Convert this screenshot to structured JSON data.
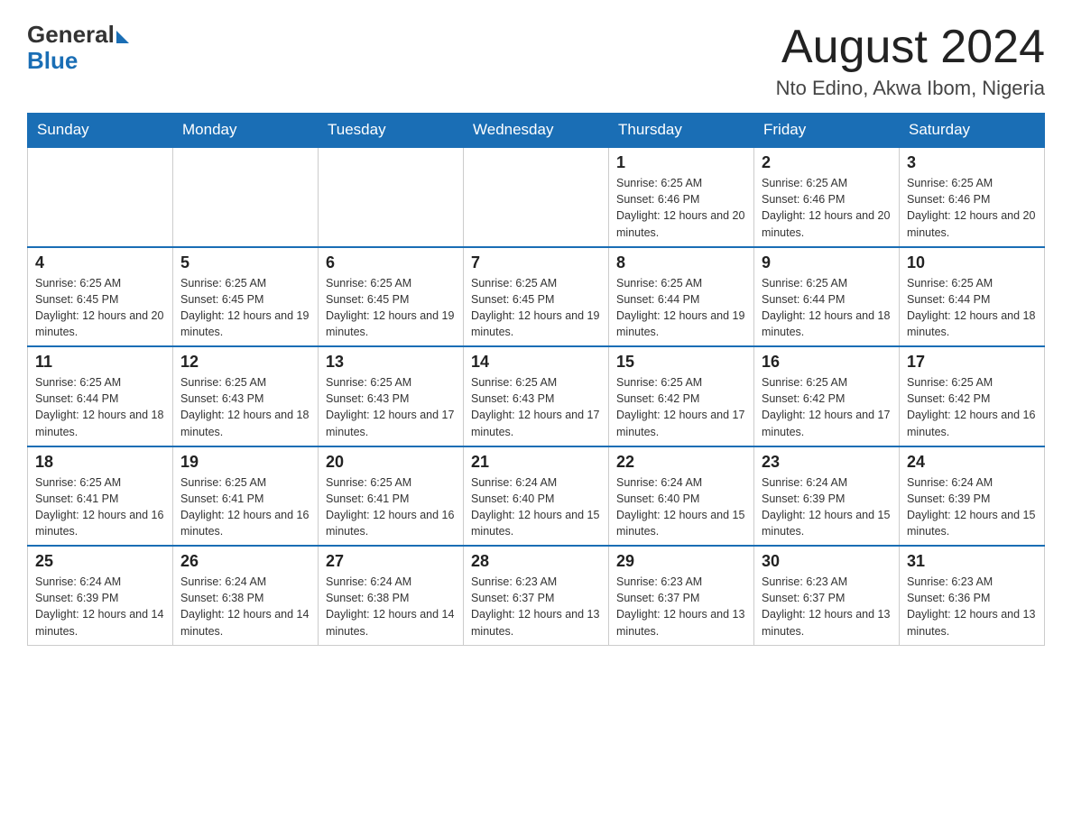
{
  "header": {
    "logo_general": "General",
    "logo_blue": "Blue",
    "title": "August 2024",
    "subtitle": "Nto Edino, Akwa Ibom, Nigeria"
  },
  "days_of_week": [
    "Sunday",
    "Monday",
    "Tuesday",
    "Wednesday",
    "Thursday",
    "Friday",
    "Saturday"
  ],
  "weeks": [
    [
      {
        "day": "",
        "sunrise": "",
        "sunset": "",
        "daylight": ""
      },
      {
        "day": "",
        "sunrise": "",
        "sunset": "",
        "daylight": ""
      },
      {
        "day": "",
        "sunrise": "",
        "sunset": "",
        "daylight": ""
      },
      {
        "day": "",
        "sunrise": "",
        "sunset": "",
        "daylight": ""
      },
      {
        "day": "1",
        "sunrise": "Sunrise: 6:25 AM",
        "sunset": "Sunset: 6:46 PM",
        "daylight": "Daylight: 12 hours and 20 minutes."
      },
      {
        "day": "2",
        "sunrise": "Sunrise: 6:25 AM",
        "sunset": "Sunset: 6:46 PM",
        "daylight": "Daylight: 12 hours and 20 minutes."
      },
      {
        "day": "3",
        "sunrise": "Sunrise: 6:25 AM",
        "sunset": "Sunset: 6:46 PM",
        "daylight": "Daylight: 12 hours and 20 minutes."
      }
    ],
    [
      {
        "day": "4",
        "sunrise": "Sunrise: 6:25 AM",
        "sunset": "Sunset: 6:45 PM",
        "daylight": "Daylight: 12 hours and 20 minutes."
      },
      {
        "day": "5",
        "sunrise": "Sunrise: 6:25 AM",
        "sunset": "Sunset: 6:45 PM",
        "daylight": "Daylight: 12 hours and 19 minutes."
      },
      {
        "day": "6",
        "sunrise": "Sunrise: 6:25 AM",
        "sunset": "Sunset: 6:45 PM",
        "daylight": "Daylight: 12 hours and 19 minutes."
      },
      {
        "day": "7",
        "sunrise": "Sunrise: 6:25 AM",
        "sunset": "Sunset: 6:45 PM",
        "daylight": "Daylight: 12 hours and 19 minutes."
      },
      {
        "day": "8",
        "sunrise": "Sunrise: 6:25 AM",
        "sunset": "Sunset: 6:44 PM",
        "daylight": "Daylight: 12 hours and 19 minutes."
      },
      {
        "day": "9",
        "sunrise": "Sunrise: 6:25 AM",
        "sunset": "Sunset: 6:44 PM",
        "daylight": "Daylight: 12 hours and 18 minutes."
      },
      {
        "day": "10",
        "sunrise": "Sunrise: 6:25 AM",
        "sunset": "Sunset: 6:44 PM",
        "daylight": "Daylight: 12 hours and 18 minutes."
      }
    ],
    [
      {
        "day": "11",
        "sunrise": "Sunrise: 6:25 AM",
        "sunset": "Sunset: 6:44 PM",
        "daylight": "Daylight: 12 hours and 18 minutes."
      },
      {
        "day": "12",
        "sunrise": "Sunrise: 6:25 AM",
        "sunset": "Sunset: 6:43 PM",
        "daylight": "Daylight: 12 hours and 18 minutes."
      },
      {
        "day": "13",
        "sunrise": "Sunrise: 6:25 AM",
        "sunset": "Sunset: 6:43 PM",
        "daylight": "Daylight: 12 hours and 17 minutes."
      },
      {
        "day": "14",
        "sunrise": "Sunrise: 6:25 AM",
        "sunset": "Sunset: 6:43 PM",
        "daylight": "Daylight: 12 hours and 17 minutes."
      },
      {
        "day": "15",
        "sunrise": "Sunrise: 6:25 AM",
        "sunset": "Sunset: 6:42 PM",
        "daylight": "Daylight: 12 hours and 17 minutes."
      },
      {
        "day": "16",
        "sunrise": "Sunrise: 6:25 AM",
        "sunset": "Sunset: 6:42 PM",
        "daylight": "Daylight: 12 hours and 17 minutes."
      },
      {
        "day": "17",
        "sunrise": "Sunrise: 6:25 AM",
        "sunset": "Sunset: 6:42 PM",
        "daylight": "Daylight: 12 hours and 16 minutes."
      }
    ],
    [
      {
        "day": "18",
        "sunrise": "Sunrise: 6:25 AM",
        "sunset": "Sunset: 6:41 PM",
        "daylight": "Daylight: 12 hours and 16 minutes."
      },
      {
        "day": "19",
        "sunrise": "Sunrise: 6:25 AM",
        "sunset": "Sunset: 6:41 PM",
        "daylight": "Daylight: 12 hours and 16 minutes."
      },
      {
        "day": "20",
        "sunrise": "Sunrise: 6:25 AM",
        "sunset": "Sunset: 6:41 PM",
        "daylight": "Daylight: 12 hours and 16 minutes."
      },
      {
        "day": "21",
        "sunrise": "Sunrise: 6:24 AM",
        "sunset": "Sunset: 6:40 PM",
        "daylight": "Daylight: 12 hours and 15 minutes."
      },
      {
        "day": "22",
        "sunrise": "Sunrise: 6:24 AM",
        "sunset": "Sunset: 6:40 PM",
        "daylight": "Daylight: 12 hours and 15 minutes."
      },
      {
        "day": "23",
        "sunrise": "Sunrise: 6:24 AM",
        "sunset": "Sunset: 6:39 PM",
        "daylight": "Daylight: 12 hours and 15 minutes."
      },
      {
        "day": "24",
        "sunrise": "Sunrise: 6:24 AM",
        "sunset": "Sunset: 6:39 PM",
        "daylight": "Daylight: 12 hours and 15 minutes."
      }
    ],
    [
      {
        "day": "25",
        "sunrise": "Sunrise: 6:24 AM",
        "sunset": "Sunset: 6:39 PM",
        "daylight": "Daylight: 12 hours and 14 minutes."
      },
      {
        "day": "26",
        "sunrise": "Sunrise: 6:24 AM",
        "sunset": "Sunset: 6:38 PM",
        "daylight": "Daylight: 12 hours and 14 minutes."
      },
      {
        "day": "27",
        "sunrise": "Sunrise: 6:24 AM",
        "sunset": "Sunset: 6:38 PM",
        "daylight": "Daylight: 12 hours and 14 minutes."
      },
      {
        "day": "28",
        "sunrise": "Sunrise: 6:23 AM",
        "sunset": "Sunset: 6:37 PM",
        "daylight": "Daylight: 12 hours and 13 minutes."
      },
      {
        "day": "29",
        "sunrise": "Sunrise: 6:23 AM",
        "sunset": "Sunset: 6:37 PM",
        "daylight": "Daylight: 12 hours and 13 minutes."
      },
      {
        "day": "30",
        "sunrise": "Sunrise: 6:23 AM",
        "sunset": "Sunset: 6:37 PM",
        "daylight": "Daylight: 12 hours and 13 minutes."
      },
      {
        "day": "31",
        "sunrise": "Sunrise: 6:23 AM",
        "sunset": "Sunset: 6:36 PM",
        "daylight": "Daylight: 12 hours and 13 minutes."
      }
    ]
  ]
}
